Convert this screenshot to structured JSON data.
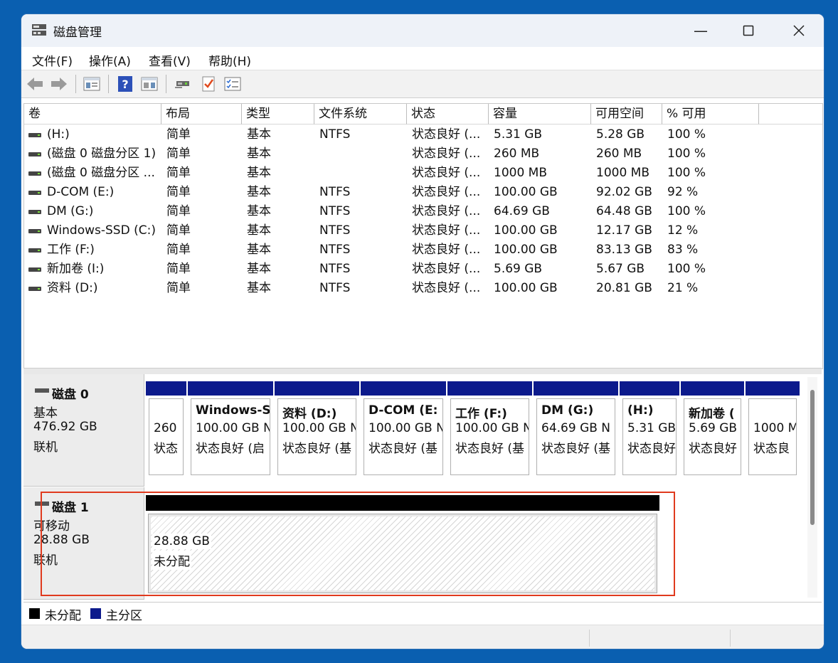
{
  "window": {
    "title": "磁盘管理"
  },
  "menu": [
    "文件(F)",
    "操作(A)",
    "查看(V)",
    "帮助(H)"
  ],
  "toolbar": [
    "back-icon",
    "forward-icon",
    "console-tree-icon",
    "help-icon",
    "show-pane-icon",
    "connect-icon",
    "check-icon",
    "properties-icon"
  ],
  "columns": [
    "卷",
    "布局",
    "类型",
    "文件系统",
    "状态",
    "容量",
    "可用空间",
    "% 可用"
  ],
  "volumes": [
    {
      "name": "(H:)",
      "layout": "简单",
      "type": "基本",
      "fs": "NTFS",
      "status": "状态良好 (...",
      "capacity": "5.31 GB",
      "free": "5.28 GB",
      "pct": "100 %"
    },
    {
      "name": "(磁盘 0 磁盘分区 1)",
      "layout": "简单",
      "type": "基本",
      "fs": "",
      "status": "状态良好 (...",
      "capacity": "260 MB",
      "free": "260 MB",
      "pct": "100 %"
    },
    {
      "name": "(磁盘 0 磁盘分区 ...",
      "layout": "简单",
      "type": "基本",
      "fs": "",
      "status": "状态良好 (...",
      "capacity": "1000 MB",
      "free": "1000 MB",
      "pct": "100 %"
    },
    {
      "name": "D-COM (E:)",
      "layout": "简单",
      "type": "基本",
      "fs": "NTFS",
      "status": "状态良好 (...",
      "capacity": "100.00 GB",
      "free": "92.02 GB",
      "pct": "92 %"
    },
    {
      "name": "DM (G:)",
      "layout": "简单",
      "type": "基本",
      "fs": "NTFS",
      "status": "状态良好 (...",
      "capacity": "64.69 GB",
      "free": "64.48 GB",
      "pct": "100 %"
    },
    {
      "name": "Windows-SSD (C:)",
      "layout": "简单",
      "type": "基本",
      "fs": "NTFS",
      "status": "状态良好 (...",
      "capacity": "100.00 GB",
      "free": "12.17 GB",
      "pct": "12 %"
    },
    {
      "name": "工作 (F:)",
      "layout": "简单",
      "type": "基本",
      "fs": "NTFS",
      "status": "状态良好 (...",
      "capacity": "100.00 GB",
      "free": "83.13 GB",
      "pct": "83 %"
    },
    {
      "name": "新加卷 (I:)",
      "layout": "简单",
      "type": "基本",
      "fs": "NTFS",
      "status": "状态良好 (...",
      "capacity": "5.69 GB",
      "free": "5.67 GB",
      "pct": "100 %"
    },
    {
      "name": "资料 (D:)",
      "layout": "简单",
      "type": "基本",
      "fs": "NTFS",
      "status": "状态良好 (...",
      "capacity": "100.00 GB",
      "free": "20.81 GB",
      "pct": "21 %"
    }
  ],
  "disk0": {
    "name": "磁盘 0",
    "type": "基本",
    "size": "476.92 GB",
    "state": "联机",
    "partitions": [
      {
        "title": "",
        "size": "260",
        "status": "状态"
      },
      {
        "title": "Windows-S",
        "size": "100.00 GB N",
        "status": "状态良好 (启"
      },
      {
        "title": "资料 (D:)",
        "size": "100.00 GB N",
        "status": "状态良好 (基"
      },
      {
        "title": "D-COM (E:",
        "size": "100.00 GB N",
        "status": "状态良好 (基"
      },
      {
        "title": "工作 (F:)",
        "size": "100.00 GB N",
        "status": "状态良好 (基"
      },
      {
        "title": "DM (G:)",
        "size": "64.69 GB N",
        "status": "状态良好 (基"
      },
      {
        "title": "(H:)",
        "size": "5.31 GB",
        "status": "状态良好"
      },
      {
        "title": "新加卷 (",
        "size": "5.69 GB",
        "status": "状态良好"
      },
      {
        "title": "",
        "size": "1000 M",
        "status": "状态良"
      }
    ]
  },
  "disk1": {
    "name": "磁盘 1",
    "type": "可移动",
    "size": "28.88 GB",
    "state": "联机",
    "unallocated": {
      "size": "28.88 GB",
      "label": "未分配"
    }
  },
  "legend": [
    {
      "label": "未分配",
      "color": "#000000"
    },
    {
      "label": "主分区",
      "color": "#0c1a8c"
    }
  ],
  "colors": {
    "primary_partition": "#0c1a8c",
    "unallocated": "#000000",
    "highlight": "#e03a1e"
  }
}
